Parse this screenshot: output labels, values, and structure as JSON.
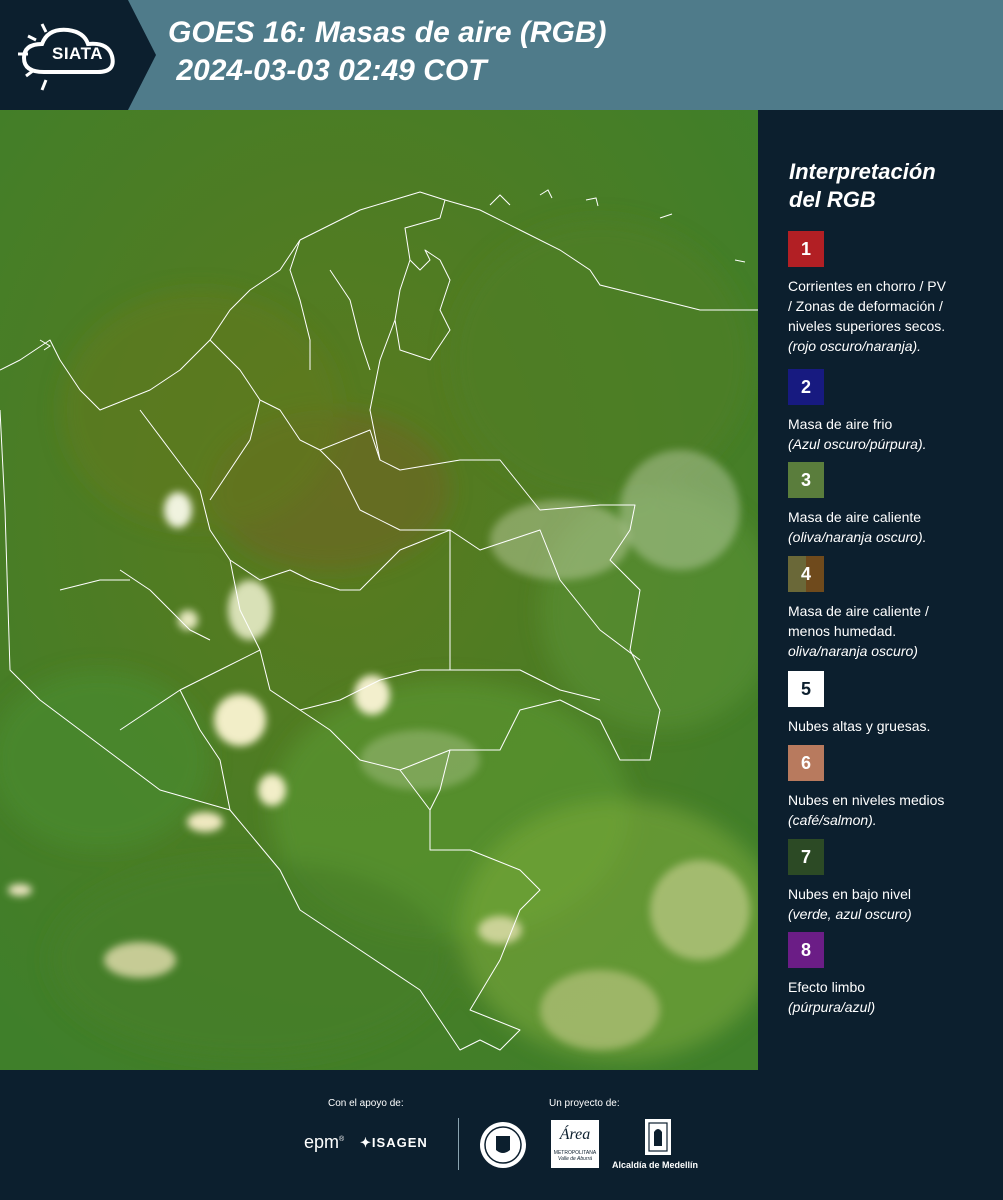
{
  "header": {
    "logo_text": "SIATA",
    "title_line1": "GOES 16: Masas de aire (RGB)",
    "title_line2": " 2024-03-03 02:49 COT"
  },
  "legend": {
    "title_line1": "Interpretación",
    "title_line2": "del RGB",
    "items": [
      {
        "num": "1",
        "color": "#b21f24",
        "lines": [
          "Corrientes en chorro / PV",
          "/ Zonas de deformación /",
          "niveles superiores secos."
        ],
        "note": "(rojo oscuro/naranja)."
      },
      {
        "num": "2",
        "color": "#171a80",
        "lines": [
          "Masa de aire frio"
        ],
        "note": "(Azul oscuro/púrpura)."
      },
      {
        "num": "3",
        "color": "#5a7d3c",
        "lines": [
          "Masa de aire caliente"
        ],
        "note": "(oliva/naranja oscuro)."
      },
      {
        "num": "4",
        "color_a": "#6a6838",
        "color_b": "#6f4a1c",
        "lines": [
          "Masa de aire caliente /",
          "menos humedad."
        ],
        "note": "oliva/naranja oscuro)"
      },
      {
        "num": "5",
        "color": "#ffffff",
        "text_color": "#0c1f2e",
        "lines": [
          "Nubes altas y gruesas."
        ],
        "note": ""
      },
      {
        "num": "6",
        "color": "#b87a5e",
        "lines": [
          "Nubes en niveles medios"
        ],
        "note": "(café/salmon)."
      },
      {
        "num": "7",
        "color": "#2c4a25",
        "lines": [
          "Nubes en bajo nivel"
        ],
        "note": "(verde, azul oscuro)"
      },
      {
        "num": "8",
        "color": "#6b1d86",
        "lines": [
          "Efecto limbo"
        ],
        "note": "(púrpura/azul)"
      }
    ]
  },
  "footer": {
    "support_label": "Con el apoyo de:",
    "project_label": "Un proyecto de:",
    "sponsor_epm": "epm",
    "sponsor_isagen": "ISAGEN",
    "sponsor_area": "Área",
    "sponsor_area_sub": "METROPOLITANA",
    "sponsor_area_sub2": "Valle de Aburrá",
    "sponsor_alcaldia": "Alcaldía de Medellín"
  },
  "colors": {
    "background": "#0c1f2e",
    "header": "#4f7b8a",
    "map_green": "#4e8a2c"
  }
}
